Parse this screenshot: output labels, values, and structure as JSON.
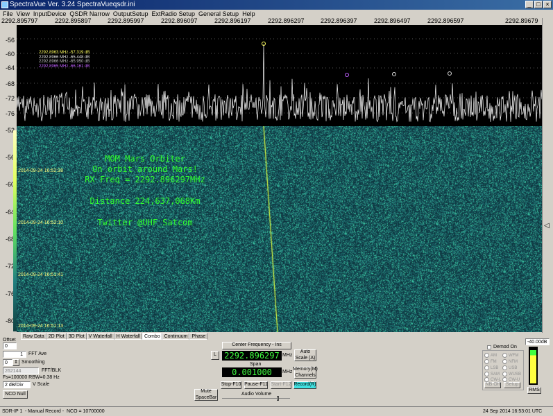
{
  "window": {
    "title": "SpectraVue Ver. 3.24  SpectraVueqsdr.ini"
  },
  "menu": [
    "File",
    "View",
    "InputDevice",
    "QSDR Narrow",
    "OutputSetup",
    "ExtRadio Setup",
    "General Setup",
    "Help"
  ],
  "freq_axis_labels": [
    "2292.895797",
    "2292.895897",
    "2292.895997",
    "2292.896097",
    "2292.896197",
    "2292.896297",
    "2292.896397",
    "2292.896497",
    "2292.896597",
    "2292.89679"
  ],
  "spectrum_y_labels": [
    "-56",
    "-60",
    "-64",
    "-68",
    "-72",
    "-76"
  ],
  "waterfall_y_labels": [
    "-52",
    "-56",
    "-60",
    "-64",
    "-68",
    "-72",
    "-76",
    "-80"
  ],
  "markers": [
    {
      "text": "2292.8963 MHz  -57.319 dB",
      "color": "#ffff60"
    },
    {
      "text": "2292.8966 MHz  -65.448 dB",
      "color": "#e0e0e0"
    },
    {
      "text": "2292.8966 MHz  -65.950 dB",
      "color": "#c0c0c0"
    },
    {
      "text": "2292.8965 MHz  -66.161 dB",
      "color": "#c060ff"
    }
  ],
  "overlay_text": {
    "line1": "MOM Mars Orbiter",
    "line2": "On orbit around Mars!",
    "line3": "RX Freq = 2292.896297MHz",
    "line4": "Distance 224,637,068Km",
    "line5": "Twitter @UHF_Satcom"
  },
  "waterfall_times": [
    "2014-09-24 16:52:38",
    "2014-09-24 16:52:10",
    "2014-09-24 16:51:41",
    "2014-09-24 16:51:13"
  ],
  "tabs": [
    "Raw Data",
    "2D Plot",
    "3D Plot",
    "V Waterfall",
    "H Waterfall",
    "Combo",
    "Continuum",
    "Phase"
  ],
  "active_tab": "Combo",
  "controls": {
    "offset_label": "Offset",
    "offset_value": "0",
    "fft_ave_value": "1",
    "fft_ave_label": "FFT Ave",
    "smoothing_value": "0",
    "smoothing_label": "Smoothing",
    "fft_blk_value": "262144",
    "fft_blk_label": "FFT/BLK",
    "fs_rbw": "Fs=100000 RBW=0.38 Hz",
    "vscale_value": "2 dB/Div",
    "vscale_label": "V Scale",
    "nco_null": "NCO Null",
    "center_freq_btn": "Center Frequency - Ins",
    "l_btn": "L",
    "center_freq_value": "2292.896297",
    "mhz_label": "MHz",
    "auto_scale": "Auto Scale (A)",
    "span_label": "Span",
    "span_value": "0.001000",
    "span_unit": "MHz",
    "memory_btn": "Memory(M) Channels",
    "stop_btn": "Stop-F10",
    "pause_btn": "Pause-F11",
    "start_btn": "Start-F12",
    "record_btn": "Record(R)",
    "mute_btn": "Mute SpaceBar",
    "audio_volume": "Audio Volume",
    "demod_label": "Demod On",
    "db_level": "-40.00dB",
    "rms_btn": "RMS",
    "nb_off": "NB Off",
    "setup_btn": "Setup",
    "modes": [
      "AM",
      "WFM",
      "FM",
      "NFM",
      "LSB",
      "USB",
      "SAM",
      "WUSB",
      "CW-L",
      "CW-U"
    ]
  },
  "status": {
    "sdr": "SDR-IP 1",
    "record": "- Manual Record -",
    "nco": "NCO = 10700000",
    "datetime": "24 Sep 2014   16:53:01 UTC"
  }
}
